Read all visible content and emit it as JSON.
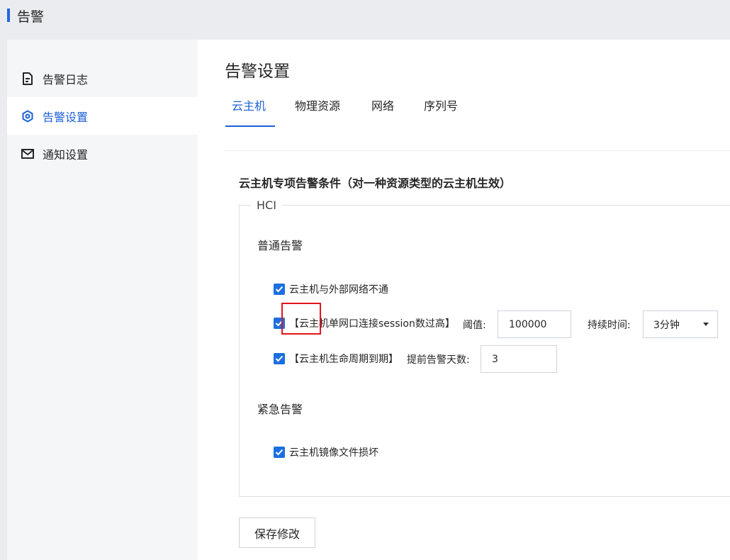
{
  "header": {
    "title": "告警"
  },
  "sidebar": {
    "items": [
      {
        "label": "告警日志",
        "icon": "document-icon"
      },
      {
        "label": "告警设置",
        "icon": "hexagon-settings-icon"
      },
      {
        "label": "通知设置",
        "icon": "mail-icon"
      }
    ],
    "active_index": 1
  },
  "main": {
    "page_title": "告警设置",
    "tabs": [
      {
        "label": "云主机"
      },
      {
        "label": "物理资源"
      },
      {
        "label": "网络"
      },
      {
        "label": "序列号"
      }
    ],
    "active_tab": 0,
    "section_title": "云主机专项告警条件（对一种资源类型的云主机生效）",
    "fieldset_legend": "HCI",
    "normal_group": {
      "title": "普通告警",
      "items": [
        {
          "label": "云主机与外部网络不通",
          "checked": true
        },
        {
          "label": "【云主机单网口连接session数过高】",
          "checked": true,
          "threshold_label": "阈值:",
          "threshold_value": "100000",
          "duration_label": "持续时间:",
          "duration_value": "3分钟"
        },
        {
          "label": "【云主机生命周期到期】",
          "checked": true,
          "days_label": "提前告警天数:",
          "days_value": "3"
        }
      ]
    },
    "urgent_group": {
      "title": "紧急告警",
      "items": [
        {
          "label": "云主机镜像文件损坏",
          "checked": true
        }
      ]
    },
    "save_label": "保存修改"
  },
  "colors": {
    "accent": "#1c5fd8",
    "checkbox": "#1c6fe0",
    "highlight": "#e0141e"
  }
}
